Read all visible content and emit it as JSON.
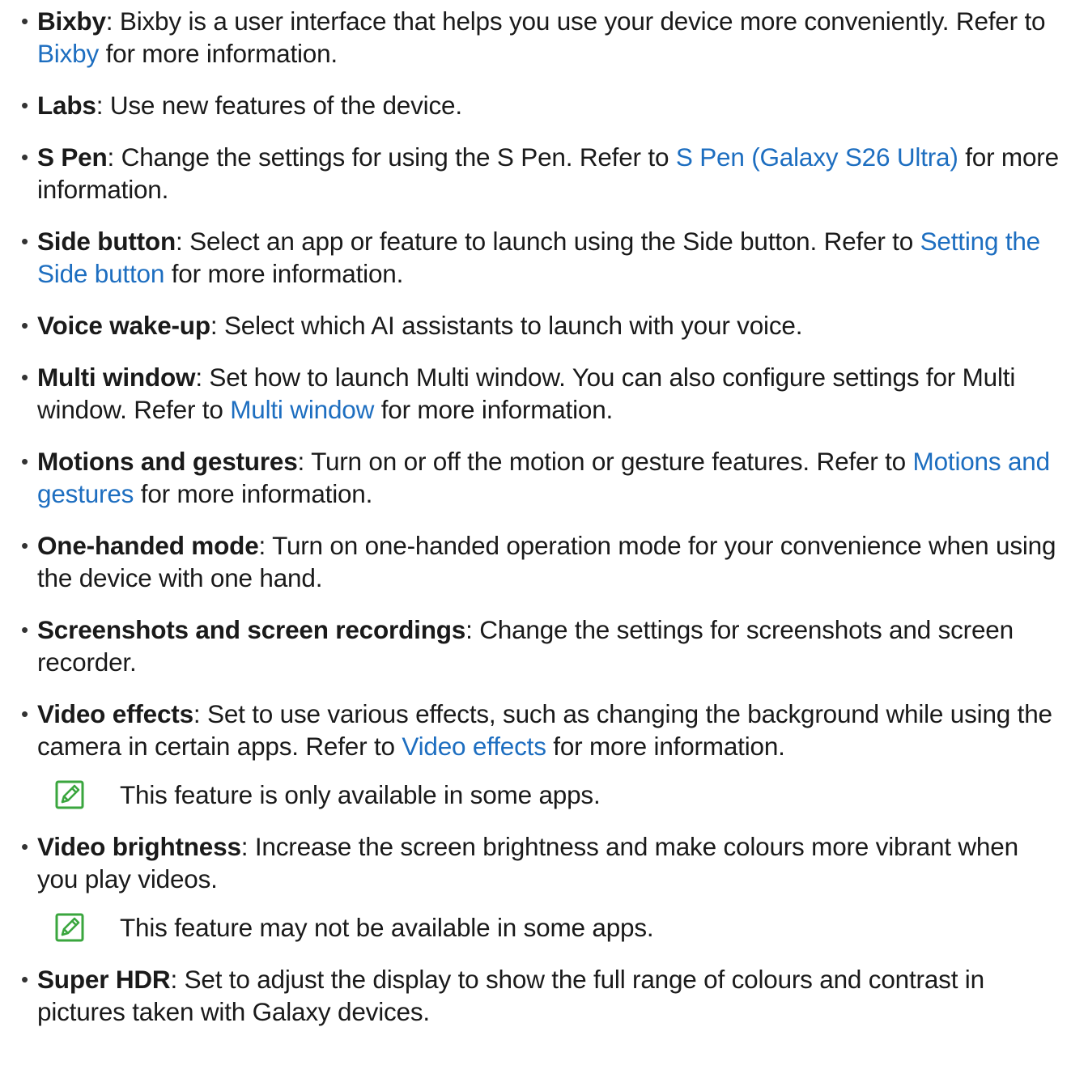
{
  "items": [
    {
      "term": "Bixby",
      "before": ": Bixby is a user interface that helps you use your device more conveniently. Refer to ",
      "link": "Bixby",
      "after": " for more information."
    },
    {
      "term": "Labs",
      "before": ": Use new features of the device."
    },
    {
      "term": "S Pen",
      "before": ": Change the settings for using the S Pen. Refer to ",
      "link": "S Pen (Galaxy S26 Ultra)",
      "after": " for more information."
    },
    {
      "term": "Side button",
      "before": ": Select an app or feature to launch using the Side button. Refer to ",
      "link": "Setting the Side button",
      "after": " for more information."
    },
    {
      "term": "Voice wake-up",
      "before": ": Select which AI assistants to launch with your voice."
    },
    {
      "term": "Multi window",
      "before": ": Set how to launch Multi window. You can also configure settings for Multi window. Refer to ",
      "link": "Multi window",
      "after": " for more information."
    },
    {
      "term": "Motions and gestures",
      "before": ": Turn on or off the motion or gesture features. Refer to ",
      "link": "Motions and gestures",
      "after": " for more information."
    },
    {
      "term": "One-handed mode",
      "before": ": Turn on one-handed operation mode for your convenience when using the device with one hand."
    },
    {
      "term": "Screenshots and screen recordings",
      "before": ": Change the settings for screenshots and screen recorder."
    },
    {
      "term": "Video effects",
      "before": ": Set to use various effects, such as changing the background while using the camera in certain apps. Refer to ",
      "link": "Video effects",
      "after": " for more information.",
      "note": "This feature is only available in some apps."
    },
    {
      "term": "Video brightness",
      "before": ": Increase the screen brightness and make colours more vibrant when you play videos.",
      "note": "This feature may not be available in some apps."
    },
    {
      "term": "Super HDR",
      "before": ": Set to adjust the display to show the full range of colours and contrast in pictures taken with Galaxy devices."
    }
  ],
  "bullet_char": "•",
  "note_icon": "note-pencil-icon",
  "colors": {
    "link": "#1d6ec0",
    "note_icon": "#3aa63e",
    "text": "#1a1a1a"
  }
}
